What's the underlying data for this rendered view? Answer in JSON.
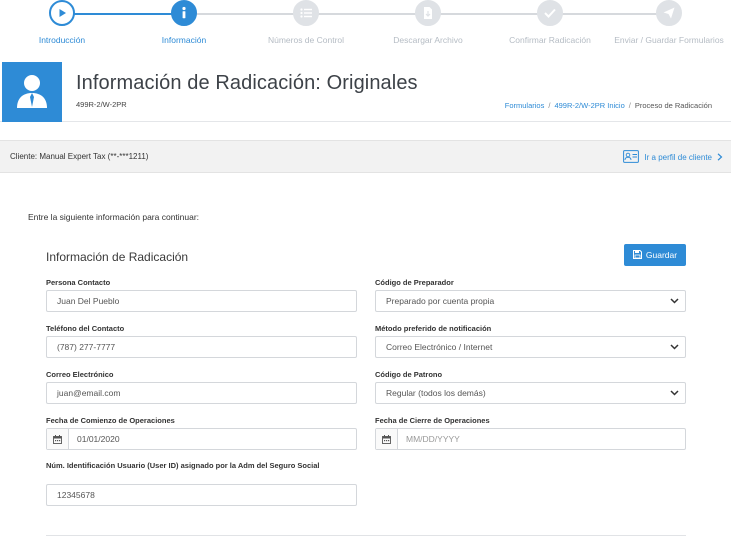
{
  "stepper": {
    "steps": [
      {
        "label": "Introducción",
        "state": "done",
        "icon": "play-icon"
      },
      {
        "label": "Información",
        "state": "current",
        "icon": "info-icon"
      },
      {
        "label": "Números de Control",
        "state": "pending",
        "icon": "list-icon"
      },
      {
        "label": "Descargar Archivo",
        "state": "pending",
        "icon": "file-download-icon"
      },
      {
        "label": "Confirmar Radicación",
        "state": "pending",
        "icon": "check-icon"
      },
      {
        "label": "Enviar / Guardar Formularios",
        "state": "pending",
        "icon": "send-icon"
      }
    ]
  },
  "header": {
    "title": "Información de Radicación: Originales",
    "subtitle": "499R-2/W-2PR",
    "avatar_icon": "user-icon",
    "breadcrumb": {
      "items": [
        "Formularios",
        "499R-2/W-2PR Inicio"
      ],
      "current": "Proceso de Radicación"
    }
  },
  "client_bar": {
    "client_text": "Cliente: Manual Expert Tax (**-***1211)",
    "profile_link": "Ir a perfil de cliente",
    "profile_icon": "id-card-icon"
  },
  "form": {
    "intro": "Entre la siguiente información para continuar:",
    "section_title": "Información de Radicación",
    "save_label": "Guardar",
    "save_icon": "save-icon",
    "contact_person": {
      "label": "Persona Contacto",
      "value": "Juan Del Pueblo"
    },
    "contact_phone": {
      "label": "Teléfono del Contacto",
      "value": "(787) 277-7777"
    },
    "email": {
      "label": "Correo Electrónico",
      "value": "juan@email.com"
    },
    "start_date": {
      "label": "Fecha de Comienzo de Operaciones",
      "value": "01/01/2020"
    },
    "user_id": {
      "label": "Núm. Identificación Usuario (User ID) asignado por la Adm del Seguro Social",
      "value": "12345678"
    },
    "preparer_code": {
      "label": "Código de Preparador",
      "value": "Preparado por cuenta propia"
    },
    "notification_method": {
      "label": "Método preferido de notificación",
      "value": "Correo Electrónico / Internet"
    },
    "employer_code": {
      "label": "Código de Patrono",
      "value": "Regular (todos los demás)"
    },
    "close_date": {
      "label": "Fecha de Cierre de Operaciones",
      "placeholder": "MM/DD/YYYY"
    }
  },
  "colors": {
    "accent": "#2e8bd6",
    "pending": "#dfe2e6",
    "client_bar_bg": "#f2f2f2"
  }
}
